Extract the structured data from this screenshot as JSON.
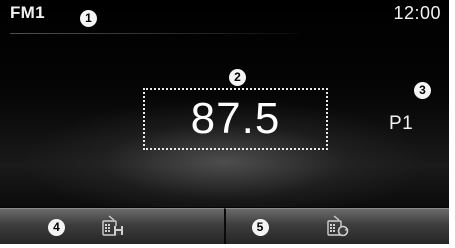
{
  "status_bar": {
    "band": "FM1",
    "time": "12:00"
  },
  "main": {
    "frequency": "87.5",
    "preset": "P1"
  },
  "softkeys": [
    {
      "icon": "radio-save-icon"
    },
    {
      "icon": "radio-scan-icon"
    }
  ],
  "callouts": {
    "band": "1",
    "frequency": "2",
    "preset": "3",
    "softkey_1": "4",
    "softkey_2": "5"
  },
  "colors": {
    "screen_background": "#050505",
    "text": "#f2f2f2",
    "softkey_top": "#6a6a6a",
    "softkey_bottom": "#262626"
  }
}
